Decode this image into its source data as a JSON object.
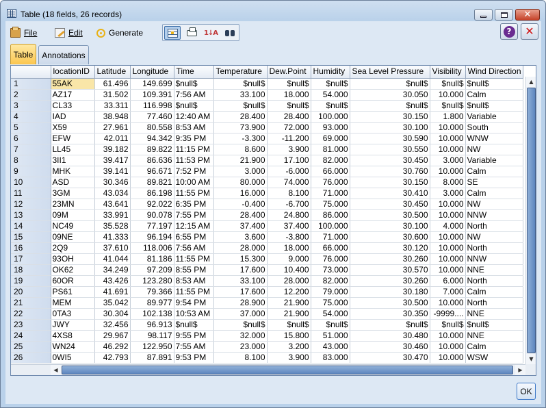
{
  "window": {
    "title": "Table (18 fields, 26 records)"
  },
  "menu": {
    "file": "File",
    "edit": "Edit",
    "generate": "Generate"
  },
  "toolbar": {
    "sort_label": "1↓A"
  },
  "tabs": [
    {
      "label": "Table",
      "active": true
    },
    {
      "label": "Annotations",
      "active": false
    }
  ],
  "table": {
    "columns": [
      "locationID",
      "Latitude",
      "Longitude",
      "Time",
      "Temperature",
      "Dew.Point",
      "Humidity",
      "Sea Level Pressure",
      "Visibility",
      "Wind Direction"
    ],
    "rows": [
      [
        "1",
        "55AK",
        "61.496",
        "149.699",
        "$null$",
        "$null$",
        "$null$",
        "$null$",
        "$null$",
        "$null$",
        "$null$"
      ],
      [
        "2",
        "AZ17",
        "31.502",
        "109.391",
        "7:56 AM",
        "33.100",
        "18.000",
        "54.000",
        "30.050",
        "10.000",
        "Calm"
      ],
      [
        "3",
        "CL33",
        "33.311",
        "116.998",
        "$null$",
        "$null$",
        "$null$",
        "$null$",
        "$null$",
        "$null$",
        "$null$"
      ],
      [
        "4",
        "IAD",
        "38.948",
        "77.460",
        "12:40 AM",
        "28.400",
        "28.400",
        "100.000",
        "30.150",
        "1.800",
        "Variable"
      ],
      [
        "5",
        "X59",
        "27.961",
        "80.558",
        "8:53 AM",
        "73.900",
        "72.000",
        "93.000",
        "30.100",
        "10.000",
        "South"
      ],
      [
        "6",
        "EFW",
        "42.011",
        "94.342",
        "9:35 PM",
        "-3.300",
        "-11.200",
        "69.000",
        "30.590",
        "10.000",
        "WNW"
      ],
      [
        "7",
        "LL45",
        "39.182",
        "89.822",
        "11:15 PM",
        "8.600",
        "3.900",
        "81.000",
        "30.550",
        "10.000",
        "NW"
      ],
      [
        "8",
        "3II1",
        "39.417",
        "86.636",
        "11:53 PM",
        "21.900",
        "17.100",
        "82.000",
        "30.450",
        "3.000",
        "Variable"
      ],
      [
        "9",
        "MHK",
        "39.141",
        "96.671",
        "7:52 PM",
        "3.000",
        "-6.000",
        "66.000",
        "30.760",
        "10.000",
        "Calm"
      ],
      [
        "10",
        "ASD",
        "30.346",
        "89.821",
        "10:00 AM",
        "80.000",
        "74.000",
        "76.000",
        "30.150",
        "8.000",
        "SE"
      ],
      [
        "11",
        "3GM",
        "43.034",
        "86.198",
        "11:55 PM",
        "16.000",
        "8.100",
        "71.000",
        "30.410",
        "3.000",
        "Calm"
      ],
      [
        "12",
        "23MN",
        "43.641",
        "92.022",
        "6:35 PM",
        "-0.400",
        "-6.700",
        "75.000",
        "30.450",
        "10.000",
        "NW"
      ],
      [
        "13",
        "09M",
        "33.991",
        "90.078",
        "7:55 PM",
        "28.400",
        "24.800",
        "86.000",
        "30.500",
        "10.000",
        "NNW"
      ],
      [
        "14",
        "NC49",
        "35.528",
        "77.197",
        "12:15 AM",
        "37.400",
        "37.400",
        "100.000",
        "30.100",
        "4.000",
        "North"
      ],
      [
        "15",
        "09NE",
        "41.333",
        "96.194",
        "6:55 PM",
        "3.600",
        "-3.800",
        "71.000",
        "30.600",
        "10.000",
        "NW"
      ],
      [
        "16",
        "2Q9",
        "37.610",
        "118.006",
        "7:56 AM",
        "28.000",
        "18.000",
        "66.000",
        "30.120",
        "10.000",
        "North"
      ],
      [
        "17",
        "93OH",
        "41.044",
        "81.186",
        "11:55 PM",
        "15.300",
        "9.000",
        "76.000",
        "30.260",
        "10.000",
        "NNW"
      ],
      [
        "18",
        "OK62",
        "34.249",
        "97.209",
        "8:55 PM",
        "17.600",
        "10.400",
        "73.000",
        "30.570",
        "10.000",
        "NNE"
      ],
      [
        "19",
        "60OR",
        "43.426",
        "123.280",
        "8:53 AM",
        "33.100",
        "28.000",
        "82.000",
        "30.260",
        "6.000",
        "North"
      ],
      [
        "20",
        "PS61",
        "41.691",
        "79.366",
        "11:55 PM",
        "17.600",
        "12.200",
        "79.000",
        "30.180",
        "7.000",
        "Calm"
      ],
      [
        "21",
        "MEM",
        "35.042",
        "89.977",
        "9:54 PM",
        "28.900",
        "21.900",
        "75.000",
        "30.500",
        "10.000",
        "North"
      ],
      [
        "22",
        "0TA3",
        "30.304",
        "102.138",
        "10:53 AM",
        "37.000",
        "21.900",
        "54.000",
        "30.350",
        "-9999....",
        "NNE"
      ],
      [
        "23",
        "JWY",
        "32.456",
        "96.913",
        "$null$",
        "$null$",
        "$null$",
        "$null$",
        "$null$",
        "$null$",
        "$null$"
      ],
      [
        "24",
        "4XS8",
        "29.967",
        "98.117",
        "9:55 PM",
        "32.000",
        "15.800",
        "51.000",
        "30.480",
        "10.000",
        "NNE"
      ],
      [
        "25",
        "WN24",
        "46.292",
        "122.950",
        "7:55 AM",
        "23.000",
        "3.200",
        "43.000",
        "30.460",
        "10.000",
        "Calm"
      ],
      [
        "26",
        "0WI5",
        "42.793",
        "87.891",
        "9:53 PM",
        "8.100",
        "3.900",
        "83.000",
        "30.470",
        "10.000",
        "WSW"
      ]
    ]
  },
  "buttons": {
    "ok": "OK"
  }
}
